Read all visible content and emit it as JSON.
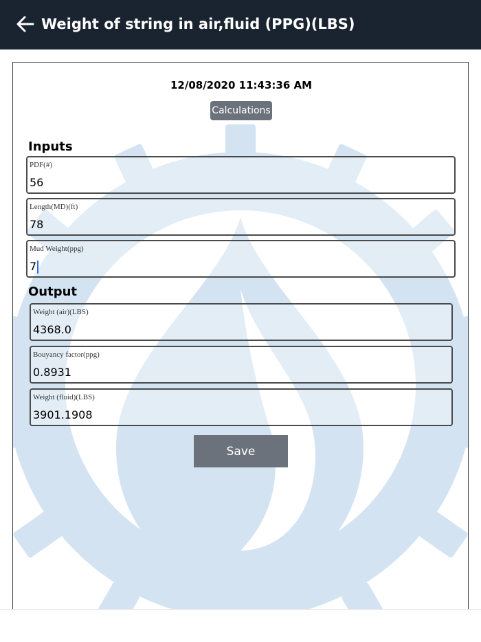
{
  "header": {
    "title": "Weight of string in air,fluid (PPG)(LBS)",
    "back_icon": "arrow-left-icon",
    "background": "#1a2430"
  },
  "card": {
    "timestamp": "12/08/2020 11:43:36 AM",
    "calculations_label": "Calculations",
    "watermark_icon": "gear-drop-logo",
    "watermark_color": "#cfe0f1"
  },
  "inputs": {
    "title": "Inputs",
    "fields": [
      {
        "label": "PDF(#)",
        "value": "56"
      },
      {
        "label": "Length(MD)(ft)",
        "value": "78"
      },
      {
        "label": "Mud Weight(ppg)",
        "value": "7"
      }
    ]
  },
  "output": {
    "title": "Output",
    "fields": [
      {
        "label": "Weight (air)(LBS)",
        "value": "4368.0"
      },
      {
        "label": "Bouyancy factor(ppg)",
        "value": "0.8931"
      },
      {
        "label": "Weight (fluid)(LBS)",
        "value": "3901.1908"
      }
    ]
  },
  "actions": {
    "save_label": "Save",
    "button_color": "#6c727b"
  }
}
